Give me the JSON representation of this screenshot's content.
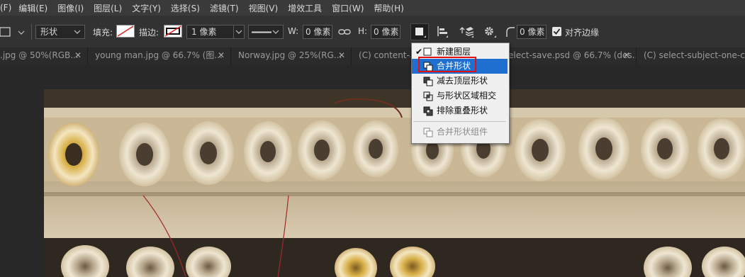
{
  "menubar": {
    "items": [
      "(F)",
      "编辑(E)",
      "图像(I)",
      "图层(L)",
      "文字(Y)",
      "选择(S)",
      "滤镜(T)",
      "视图(V)",
      "增效工具",
      "窗口(W)",
      "帮助(H)"
    ]
  },
  "options": {
    "mode_value": "形状",
    "fill_label": "填充:",
    "stroke_label": "描边:",
    "stroke_width_value": "1 像素",
    "w_label": "W:",
    "w_value": "0 像素",
    "h_label": "H:",
    "h_value": "0 像素",
    "radius_value": "0 像素",
    "align_edges_label": "对齐边缘",
    "align_edges_checked": true
  },
  "tabs": [
    {
      "title": ".jpg @ 50%(RGB..."
    },
    {
      "title": "young man.jpg @ 66.7% (图..."
    },
    {
      "title": "Norway.jpg @ 25%(RG..."
    },
    {
      "title": "(C) content-aw"
    },
    {
      "title": "elect-save.psd @ 66.7% (des..."
    },
    {
      "title": "(C) select-subject-one-click"
    }
  ],
  "dropdown": {
    "items": [
      {
        "label": "新建图层",
        "checked": true,
        "highlighted": false,
        "disabled": false,
        "icon": "new-layer-icon"
      },
      {
        "label": "合并形状",
        "checked": false,
        "highlighted": true,
        "disabled": false,
        "icon": "combine-shapes-icon"
      },
      {
        "label": "减去顶层形状",
        "checked": false,
        "highlighted": false,
        "disabled": false,
        "icon": "subtract-front-shape-icon"
      },
      {
        "label": "与形状区域相交",
        "checked": false,
        "highlighted": false,
        "disabled": false,
        "icon": "intersect-shape-icon"
      },
      {
        "label": "排除重叠形状",
        "checked": false,
        "highlighted": false,
        "disabled": false,
        "icon": "exclude-overlap-icon"
      },
      {
        "label": "合并形状组件",
        "checked": false,
        "highlighted": false,
        "disabled": true,
        "icon": "merge-components-icon"
      }
    ]
  },
  "colors": {
    "menubar_bg": "#3a3a3a",
    "optbar_bg": "#323232",
    "highlight": "#1f6fd1",
    "annotation_red": "#e01010"
  }
}
